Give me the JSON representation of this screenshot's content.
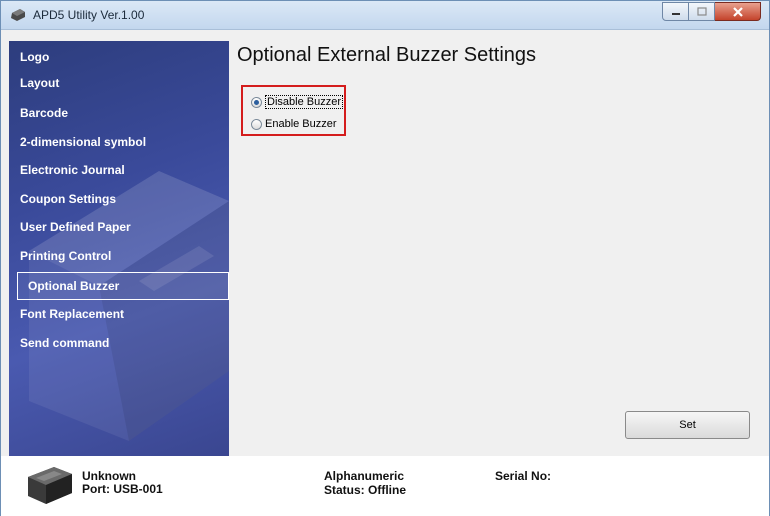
{
  "window": {
    "title": "APD5 Utility Ver.1.00"
  },
  "sidebar": {
    "items": [
      {
        "label": "Logo",
        "active": false
      },
      {
        "label": "Layout",
        "active": false
      },
      {
        "label": "Barcode",
        "active": false
      },
      {
        "label": "2-dimensional symbol",
        "active": false
      },
      {
        "label": "Electronic Journal",
        "active": false
      },
      {
        "label": "Coupon Settings",
        "active": false
      },
      {
        "label": "User Defined Paper",
        "active": false
      },
      {
        "label": "Printing Control",
        "active": false
      },
      {
        "label": "Optional Buzzer",
        "active": true
      },
      {
        "label": "Font Replacement",
        "active": false
      },
      {
        "label": "Send command",
        "active": false
      }
    ]
  },
  "main": {
    "title": "Optional External Buzzer Settings",
    "options": [
      {
        "label": "Disable Buzzer",
        "checked": true
      },
      {
        "label": "Enable Buzzer",
        "checked": false
      }
    ],
    "set_label": "Set"
  },
  "footer": {
    "device_name": "Unknown",
    "port": "Port: USB-001",
    "font_type": "Alphanumeric",
    "status": "Status: Offline",
    "serial": "Serial No:"
  },
  "colors": {
    "highlight": "#d41c1c",
    "sidebar": "#3a4a9a"
  }
}
